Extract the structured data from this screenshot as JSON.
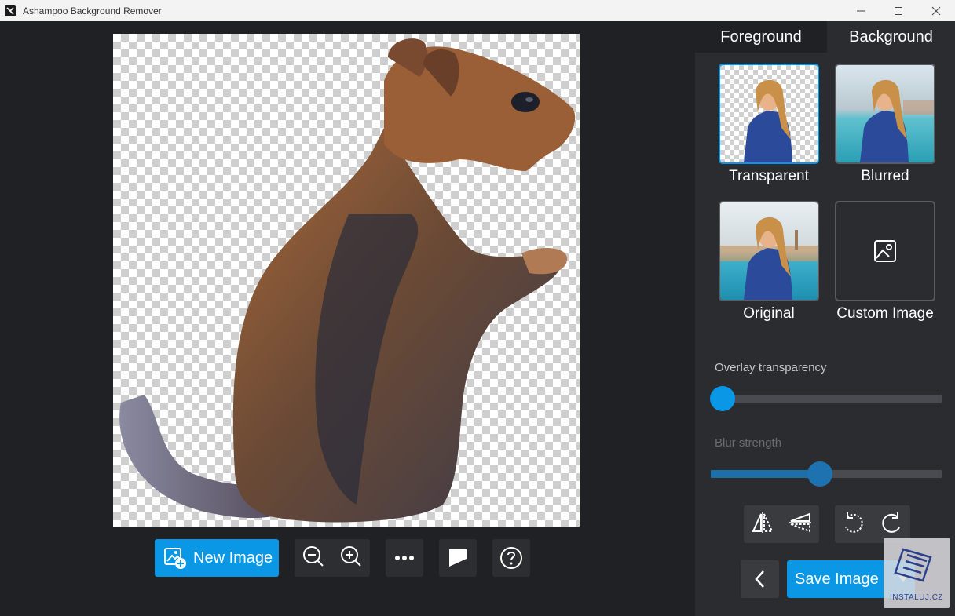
{
  "window": {
    "title": "Ashampoo Background Remover",
    "controls": {
      "minimize": "—",
      "maximize": "☐",
      "close": "✕"
    }
  },
  "toolbar": {
    "new_image_label": "New Image",
    "buttons": [
      "zoom-out-icon",
      "zoom-in-icon",
      "more-icon",
      "compare-icon",
      "help-icon"
    ]
  },
  "side_panel": {
    "tabs": [
      {
        "label": "Foreground",
        "active": false
      },
      {
        "label": "Background",
        "active": true
      }
    ],
    "options": [
      {
        "label": "Transparent",
        "selected": true
      },
      {
        "label": "Blurred",
        "selected": false
      },
      {
        "label": "Original",
        "selected": false
      },
      {
        "label": "Custom Image",
        "selected": false
      }
    ],
    "overlay_label": "Overlay transparency",
    "overlay_value": 0.05,
    "blur_label": "Blur strength",
    "blur_value": 0.47,
    "save_label": "Save Image"
  },
  "watermark": {
    "text": "INSTALUJ.CZ"
  },
  "colors": {
    "accent": "#0a97e6",
    "panel": "#2b2c30",
    "background": "#202124"
  }
}
